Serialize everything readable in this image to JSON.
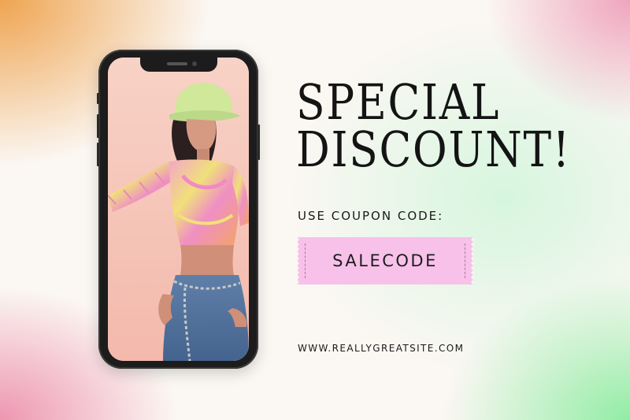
{
  "headline": {
    "line1": "SPECIAL",
    "line2": "DISCOUNT!"
  },
  "coupon": {
    "label": "USE COUPON CODE:",
    "code": "SALECODE"
  },
  "website": "WWW.REALLYGREATSITE.COM",
  "colors": {
    "ticket": "#f7c1ea",
    "phone_frame": "#1c1c1c",
    "screen_background": "#f6c6bb",
    "text": "#141414"
  }
}
